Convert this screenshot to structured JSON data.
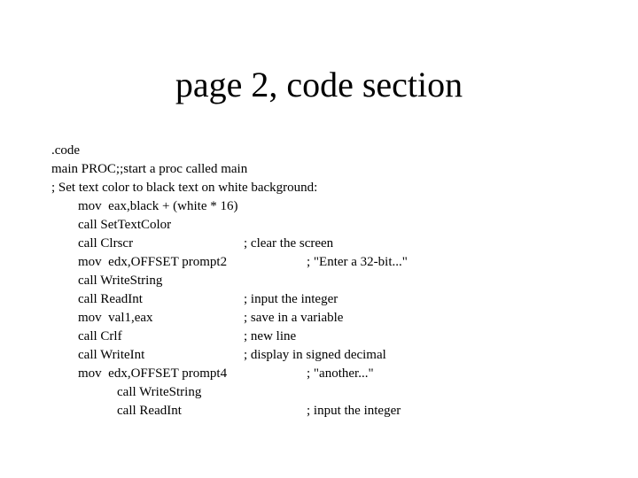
{
  "slide": {
    "title": "page 2, code section",
    "lines": [
      {
        "code": ".code",
        "comment": ""
      },
      {
        "code": "main PROC;;start a proc called main",
        "comment": ""
      },
      {
        "code": "; Set text color to black text on white background:",
        "comment": ""
      },
      {
        "code": "mov  eax,black + (white * 16)",
        "comment": ""
      },
      {
        "code": "call SetTextColor",
        "comment": ""
      },
      {
        "code": "call Clrscr",
        "comment": "; clear the screen"
      },
      {
        "code": "mov  edx,OFFSET prompt2",
        "comment": "; \"Enter a 32-bit...\""
      },
      {
        "code": "call WriteString",
        "comment": ""
      },
      {
        "code": "call ReadInt",
        "comment": "; input the integer"
      },
      {
        "code": "mov  val1,eax",
        "comment": "; save in a variable"
      },
      {
        "code": "call Crlf",
        "comment": "; new line"
      },
      {
        "code": "call WriteInt",
        "comment": "; display in signed decimal"
      },
      {
        "code": "mov  edx,OFFSET prompt4",
        "comment": "; \"another...\""
      },
      {
        "code": "call WriteString",
        "comment": ""
      },
      {
        "code": "call ReadInt",
        "comment": "; input the integer"
      }
    ]
  }
}
